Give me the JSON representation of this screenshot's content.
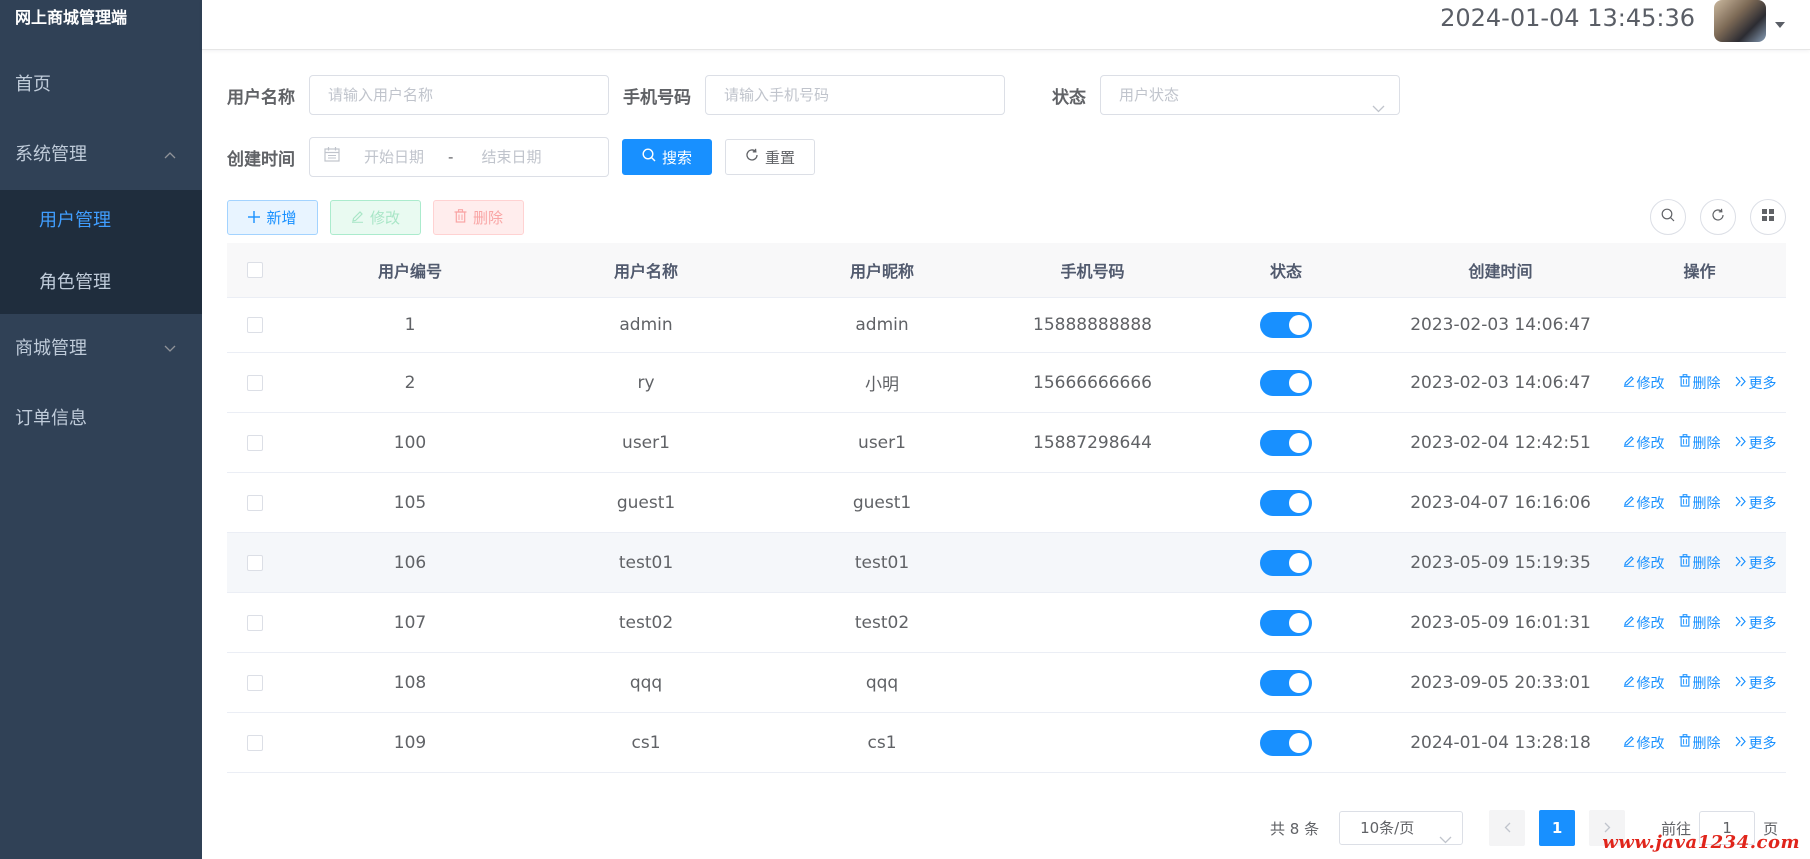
{
  "sidebar": {
    "brand": "网上商城管理端",
    "items": [
      {
        "label": "首页"
      },
      {
        "label": "系统管理"
      },
      {
        "label": "用户管理"
      },
      {
        "label": "角色管理"
      },
      {
        "label": "商城管理"
      },
      {
        "label": "订单信息"
      }
    ]
  },
  "header": {
    "datetime": "2024-01-04 13:45:36"
  },
  "filters": {
    "username_label": "用户名称",
    "username_placeholder": "请输入用户名称",
    "phone_label": "手机号码",
    "phone_placeholder": "请输入手机号码",
    "status_label": "状态",
    "status_placeholder": "用户状态",
    "created_label": "创建时间",
    "start_placeholder": "开始日期",
    "range_separator": "-",
    "end_placeholder": "结束日期",
    "search_label": "搜索",
    "reset_label": "重置"
  },
  "toolbar": {
    "add_label": "新增",
    "edit_label": "修改",
    "delete_label": "删除"
  },
  "table": {
    "columns": [
      "用户编号",
      "用户名称",
      "用户昵称",
      "手机号码",
      "状态",
      "创建时间",
      "操作"
    ],
    "rows": [
      {
        "id": "1",
        "name": "admin",
        "nick": "admin",
        "phone": "15888888888",
        "enabled": true,
        "created": "2023-02-03 14:06:47",
        "ops": false
      },
      {
        "id": "2",
        "name": "ry",
        "nick": "小明",
        "phone": "15666666666",
        "enabled": true,
        "created": "2023-02-03 14:06:47",
        "ops": true
      },
      {
        "id": "100",
        "name": "user1",
        "nick": "user1",
        "phone": "15887298644",
        "enabled": true,
        "created": "2023-02-04 12:42:51",
        "ops": true
      },
      {
        "id": "105",
        "name": "guest1",
        "nick": "guest1",
        "phone": "",
        "enabled": true,
        "created": "2023-04-07 16:16:06",
        "ops": true
      },
      {
        "id": "106",
        "name": "test01",
        "nick": "test01",
        "phone": "",
        "enabled": true,
        "created": "2023-05-09 15:19:35",
        "ops": true
      },
      {
        "id": "107",
        "name": "test02",
        "nick": "test02",
        "phone": "",
        "enabled": true,
        "created": "2023-05-09 16:01:31",
        "ops": true
      },
      {
        "id": "108",
        "name": "qqq",
        "nick": "qqq",
        "phone": "",
        "enabled": true,
        "created": "2023-09-05 20:33:01",
        "ops": true
      },
      {
        "id": "109",
        "name": "cs1",
        "nick": "cs1",
        "phone": "",
        "enabled": true,
        "created": "2024-01-04 13:28:18",
        "ops": true
      }
    ],
    "row_ops": {
      "edit": "修改",
      "delete": "删除",
      "more": "更多"
    }
  },
  "pagination": {
    "total": "共 8 条",
    "page_size": "10条/页",
    "current_page": "1",
    "goto_prefix": "前往",
    "goto_value": "1",
    "goto_suffix": "页"
  },
  "watermark": "www.java1234.com",
  "colors": {
    "sidebar_bg": "#304156",
    "primary": "#1890ff",
    "active_menu": "#409eff"
  }
}
